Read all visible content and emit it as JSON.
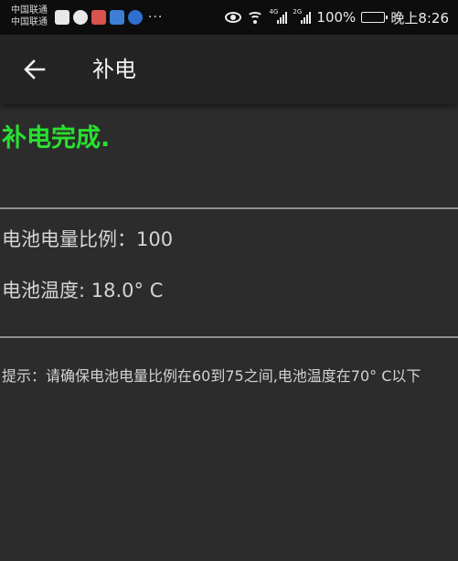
{
  "statusbar": {
    "carrier_line1": "中国联通",
    "carrier_line2": "中国联通",
    "more": "···",
    "net1": "4G",
    "net2": "2G",
    "battery_percent": "100%",
    "time": "晚上8:26"
  },
  "toolbar": {
    "title": "补电"
  },
  "main": {
    "status_message": "补电完成.",
    "status_color": "#29e02f",
    "battery_level_label": "电池电量比例：",
    "battery_level_value": "100",
    "battery_temp_label": "电池温度:",
    "battery_temp_value": "18.0° C",
    "hint": "提示：请确保电池电量比例在60到75之间,电池温度在70° C以下"
  }
}
